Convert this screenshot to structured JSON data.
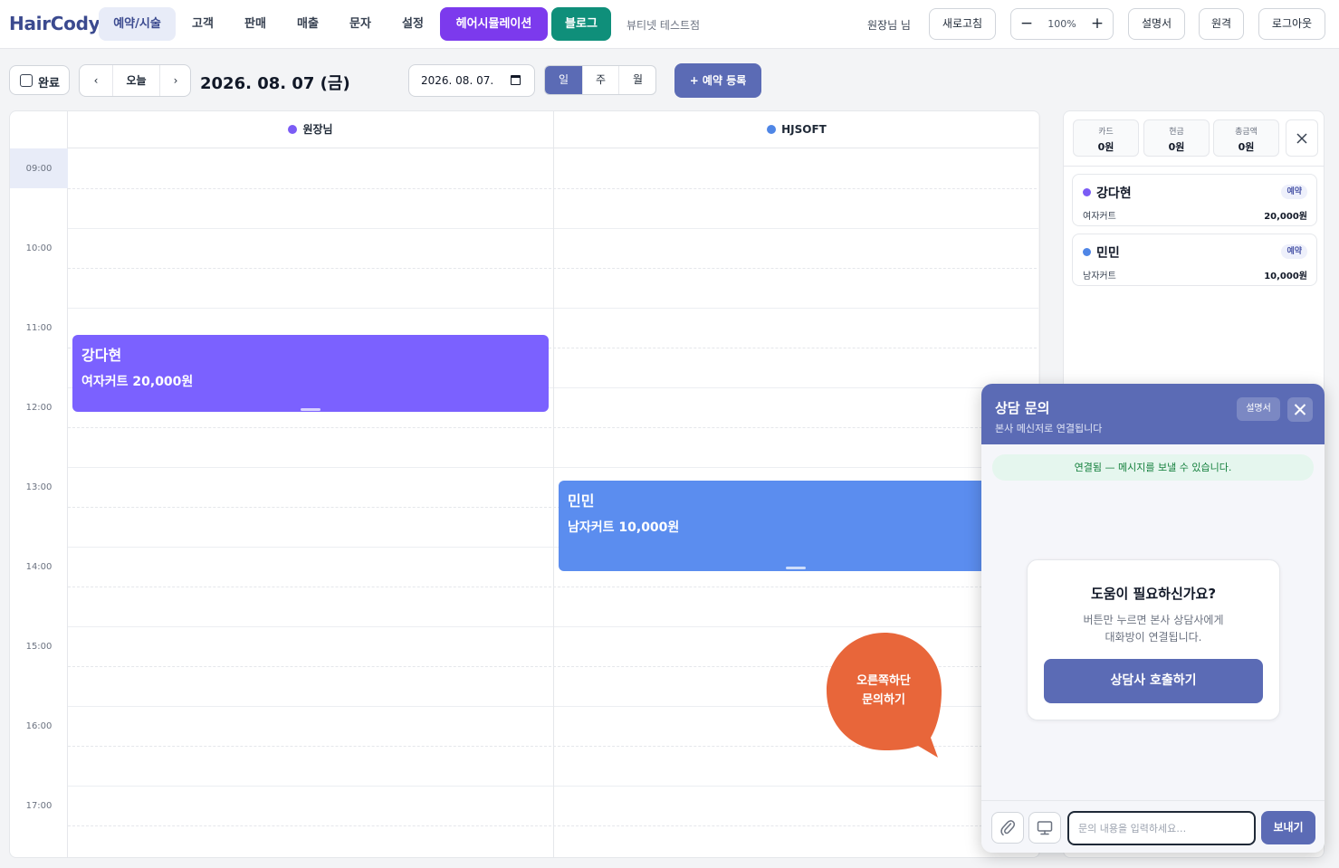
{
  "app": {
    "logo": "HairCody"
  },
  "nav": {
    "items": [
      {
        "label": "예약/시술"
      },
      {
        "label": "고객"
      },
      {
        "label": "판매"
      },
      {
        "label": "매출"
      },
      {
        "label": "문자"
      },
      {
        "label": "설정"
      }
    ],
    "simulation": "헤어시뮬레이션",
    "blog": "블로그",
    "shop_name": "뷰티넷 테스트점"
  },
  "header_right": {
    "user": "원장님 님",
    "refresh": "새로고침",
    "zoom_minus": "−",
    "zoom_level": "100%",
    "zoom_plus": "+",
    "manual": "설명서",
    "remote": "원격",
    "logout": "로그아웃"
  },
  "toolbar": {
    "complete_label": "완료",
    "prev": "‹",
    "today": "오늘",
    "next": "›",
    "current_date": "2026. 08. 07 (금)",
    "date_value": "2026. 08. 07.",
    "view_day": "일",
    "view_week": "주",
    "view_month": "월",
    "add_reservation": "+ 예약 등록"
  },
  "calendar": {
    "columns": [
      {
        "name": "원장님",
        "color": "#7b5cf5"
      },
      {
        "name": "HJSOFT",
        "color": "#4f86e6"
      }
    ],
    "hours": [
      "09:00",
      "10:00",
      "11:00",
      "12:00",
      "13:00",
      "14:00",
      "15:00",
      "16:00",
      "17:00"
    ],
    "appointments": [
      {
        "name": "강다현",
        "service": "여자커트 20,000원",
        "color": "#7b61ff"
      },
      {
        "name": "민민",
        "service": "남자커트 10,000원",
        "color": "#5b8def"
      }
    ]
  },
  "summary": {
    "card": {
      "label": "카드",
      "value": "0원"
    },
    "cash": {
      "label": "현금",
      "value": "0원"
    },
    "total": {
      "label": "총금액",
      "value": "0원"
    }
  },
  "reservations": [
    {
      "name": "강다현",
      "badge": "예약",
      "service": "여자커트",
      "price": "20,000원",
      "color": "#7b5cf5"
    },
    {
      "name": "민민",
      "badge": "예약",
      "service": "남자커트",
      "price": "10,000원",
      "color": "#4f86e6"
    }
  ],
  "bubble": {
    "line1": "오른쪽하단",
    "line2": "문의하기",
    "color": "#e8663a"
  },
  "chat": {
    "title": "상담 문의",
    "subtitle": "본사 메신저로 연결됩니다",
    "manual": "설명서",
    "status": "연결됨 — 메시지를 보낼 수 있습니다.",
    "help_title": "도움이 필요하신가요?",
    "help_desc_1": "버튼만 누르면 본사 상담사에게",
    "help_desc_2": "대화방이 연결됩니다.",
    "call_button": "상담사 호출하기",
    "input_placeholder": "문의 내용을 입력하세요…",
    "send": "보내기"
  },
  "colors": {
    "accent": "#5b6bb5",
    "simulation": "#7c3aed",
    "blog": "#0f8f7a"
  }
}
